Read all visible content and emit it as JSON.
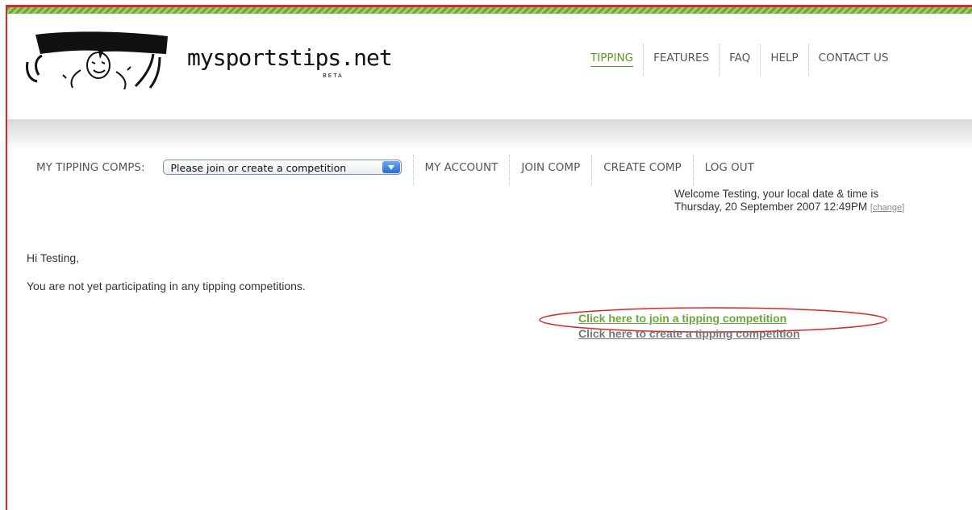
{
  "brand": {
    "name": "mysportstips.net",
    "beta": "BETA",
    "accent": "#5a9a1e",
    "frame_color": "#d9262b"
  },
  "topnav": [
    {
      "label": "TIPPING",
      "active": true
    },
    {
      "label": "FEATURES"
    },
    {
      "label": "FAQ"
    },
    {
      "label": "HELP"
    },
    {
      "label": "CONTACT US"
    }
  ],
  "subnav": {
    "label": "MY TIPPING COMPS:",
    "select_value": "Please join or create a competition",
    "items": [
      "MY ACCOUNT",
      "JOIN COMP",
      "CREATE COMP",
      "LOG OUT"
    ]
  },
  "welcome": {
    "line1": "Welcome Testing, your local date & time is",
    "line2": "Thursday, 20 September 2007 12:49PM",
    "change_open": "[",
    "change": "change",
    "change_close": "]"
  },
  "main": {
    "greeting": "Hi Testing,",
    "message": "You are not yet participating in any tipping competitions.",
    "join_link": "Click here to join a tipping competition",
    "create_link": "Click here to create a tipping competition"
  }
}
